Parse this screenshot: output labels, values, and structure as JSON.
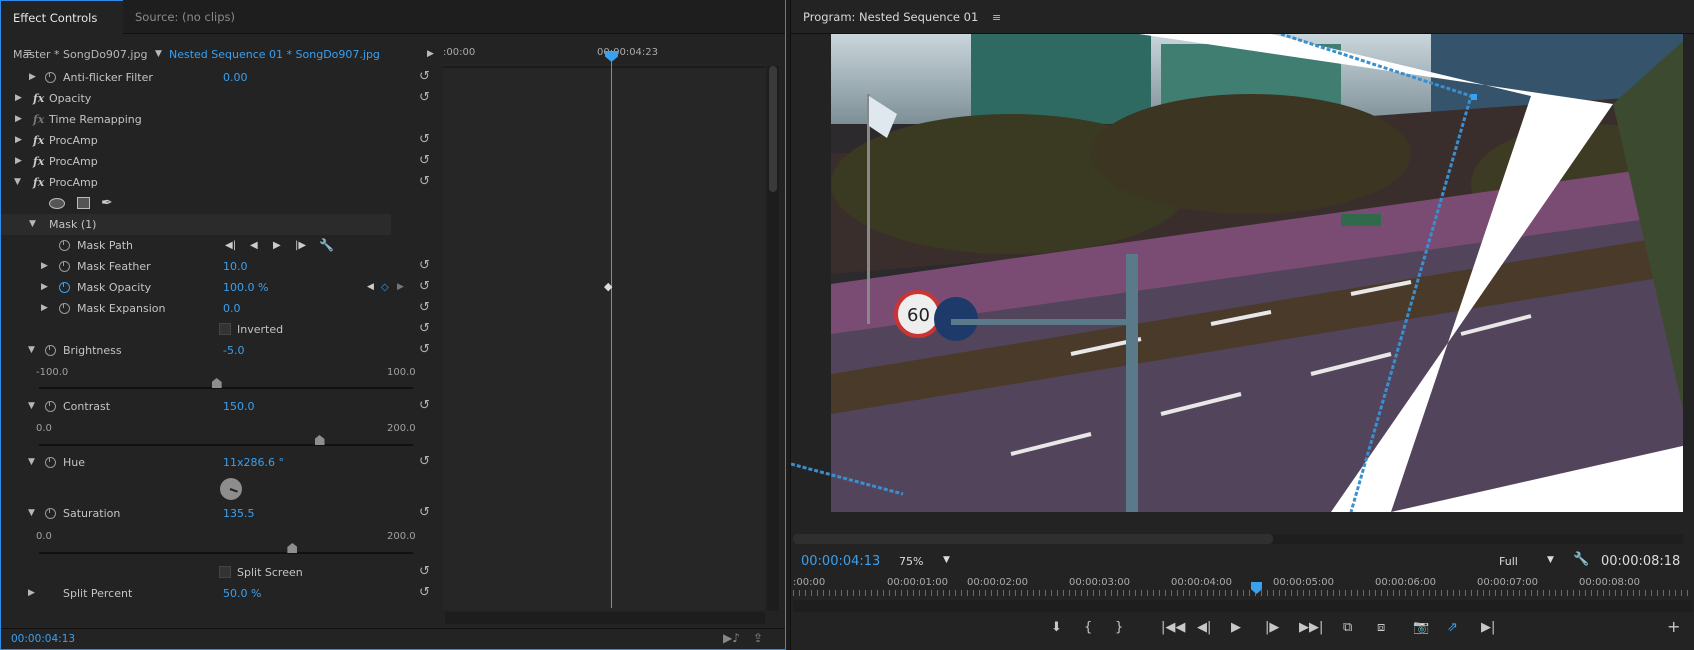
{
  "effect_controls": {
    "tab_active": "Effect Controls",
    "tab_inactive": "Source: (no clips)",
    "menu": "≡",
    "master_clip": "Master * SongDo907.jpg",
    "sequence_clip": "Nested Sequence 01 * SongDo907.jpg",
    "timeline_start": ":00:00",
    "timeline_mark": "00:00:04:23",
    "rows": {
      "anti_flicker": {
        "label": "Anti-flicker Filter",
        "value": "0.00"
      },
      "opacity": {
        "label": "Opacity"
      },
      "time_remap": {
        "label": "Time Remapping"
      },
      "procamp1": {
        "label": "ProcAmp"
      },
      "procamp2": {
        "label": "ProcAmp"
      },
      "procamp3": {
        "label": "ProcAmp"
      },
      "mask": {
        "label": "Mask (1)"
      },
      "mask_path": {
        "label": "Mask Path"
      },
      "mask_feather": {
        "label": "Mask Feather",
        "value": "10.0"
      },
      "mask_opacity": {
        "label": "Mask Opacity",
        "value": "100.0 %"
      },
      "mask_expansion": {
        "label": "Mask Expansion",
        "value": "0.0"
      },
      "inverted": {
        "label": "Inverted"
      },
      "brightness": {
        "label": "Brightness",
        "value": "-5.0",
        "min": "-100.0",
        "max": "100.0",
        "level": 0.475
      },
      "contrast": {
        "label": "Contrast",
        "value": "150.0",
        "min": "0.0",
        "max": "200.0",
        "level": 0.75
      },
      "hue": {
        "label": "Hue",
        "value": "11x286.6 °"
      },
      "saturation": {
        "label": "Saturation",
        "value": "135.5",
        "min": "0.0",
        "max": "200.0",
        "level": 0.6775
      },
      "split_screen": {
        "label": "Split Screen"
      },
      "split_percent": {
        "label": "Split Percent",
        "value": "50.0 %"
      }
    },
    "current_time": "00:00:04:13"
  },
  "program_monitor": {
    "title": "Program: Nested Sequence 01",
    "menu": "≡",
    "timecode": "00:00:04:13",
    "zoom": "75%",
    "quality": "Full",
    "duration": "00:00:08:18",
    "ruler_labels": [
      ":00:00",
      "00:00:01:00",
      "00:00:02:00",
      "00:00:03:00",
      "00:00:04:00",
      "00:00:05:00",
      "00:00:06:00",
      "00:00:07:00",
      "00:00:08:00"
    ]
  },
  "icons": {
    "reset": "↺",
    "wrench": "🔧"
  }
}
